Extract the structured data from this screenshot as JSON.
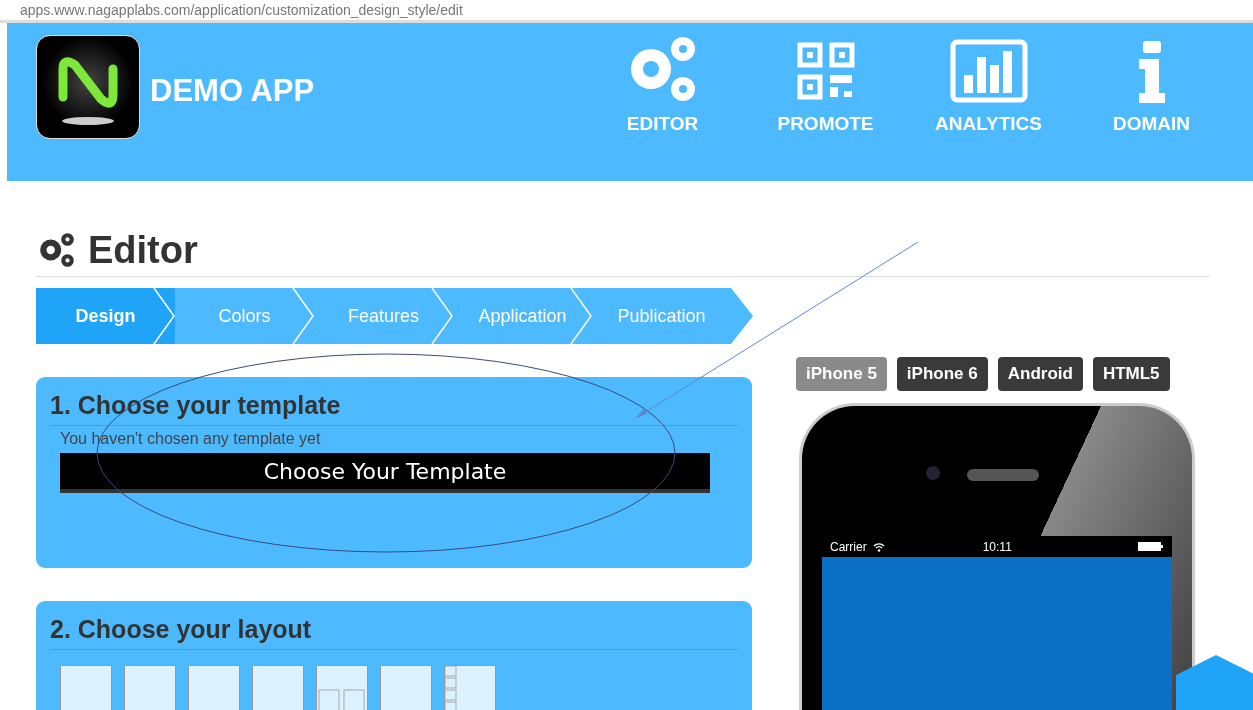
{
  "address_bar": {
    "url": "apps.www.nagapplabs.com/application/customization_design_style/edit"
  },
  "header": {
    "app_name": "DEMO APP",
    "nav": [
      {
        "label": "EDITOR"
      },
      {
        "label": "PROMOTE"
      },
      {
        "label": "ANALYTICS"
      },
      {
        "label": "DOMAIN"
      }
    ]
  },
  "page_title": "Editor",
  "steps": [
    {
      "label": "Design",
      "selected": true
    },
    {
      "label": "Colors",
      "selected": false
    },
    {
      "label": "Features",
      "selected": false
    },
    {
      "label": "Application",
      "selected": false
    },
    {
      "label": "Publication",
      "selected": false
    }
  ],
  "template_card": {
    "title": "1. Choose your template",
    "message": "You haven't chosen any template yet",
    "button": "Choose Your Template"
  },
  "layout_card": {
    "title": "2. Choose your layout",
    "layouts": [
      {
        "kind": "plain"
      },
      {
        "kind": "plain"
      },
      {
        "kind": "plain"
      },
      {
        "kind": "plain"
      },
      {
        "kind": "split"
      },
      {
        "kind": "plain"
      },
      {
        "kind": "list"
      }
    ]
  },
  "devices": [
    {
      "label": "iPhone 5",
      "selected": true
    },
    {
      "label": "iPhone 6",
      "selected": false
    },
    {
      "label": "Android",
      "selected": false
    },
    {
      "label": "HTML5",
      "selected": false
    }
  ],
  "phone": {
    "carrier": "Carrier",
    "time": "10:11"
  }
}
